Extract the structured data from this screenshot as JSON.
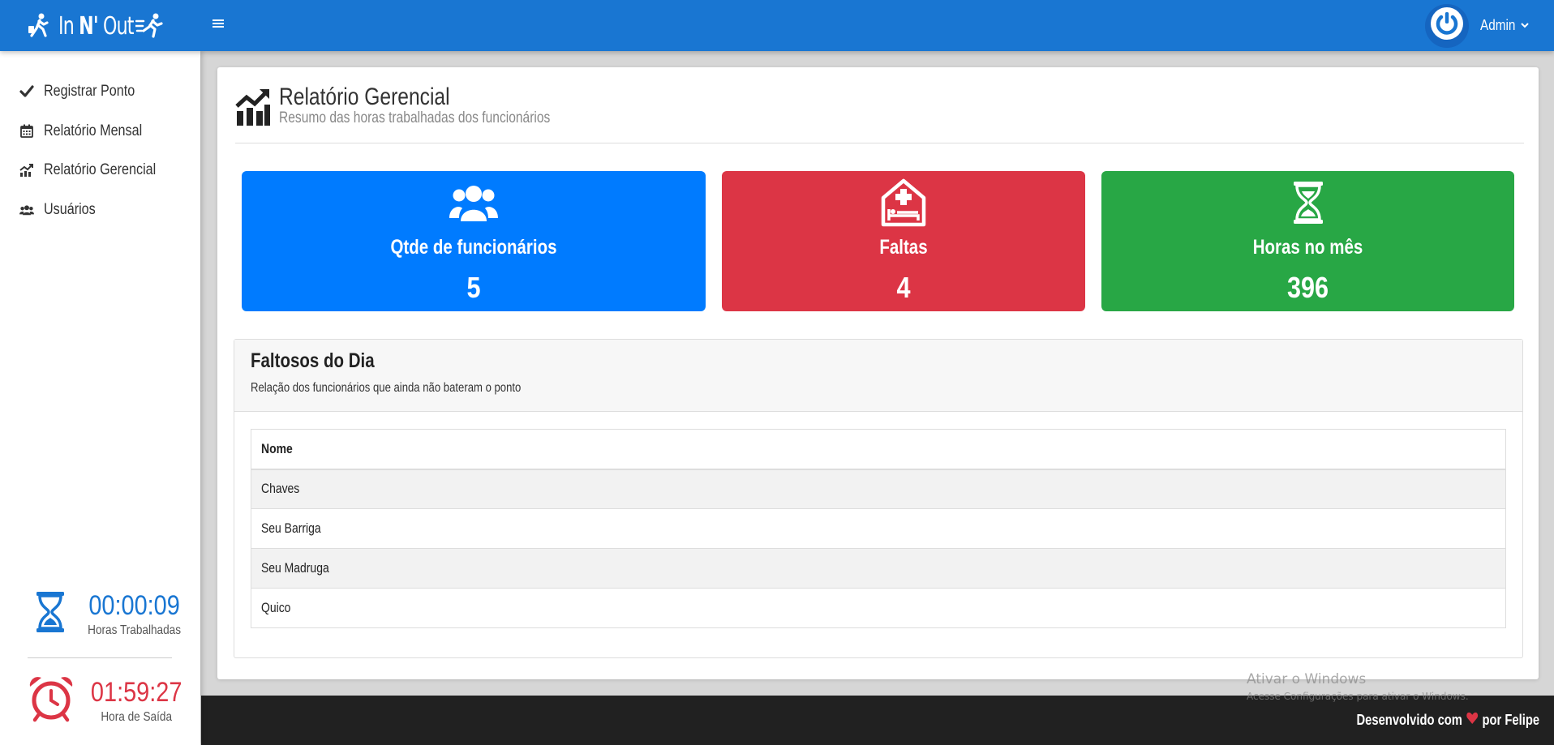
{
  "app": {
    "brand_prefix": "In ",
    "brand_bold": "N'",
    "brand_suffix": " Out"
  },
  "header": {
    "user_name": "Admin"
  },
  "sidebar": {
    "items": [
      {
        "label": "Registrar Ponto",
        "icon": "check-icon"
      },
      {
        "label": "Relatório Mensal",
        "icon": "calendar-icon"
      },
      {
        "label": "Relatório Gerencial",
        "icon": "chart-line-icon"
      },
      {
        "label": "Usuários",
        "icon": "users-icon"
      }
    ],
    "worked": {
      "value": "00:00:09",
      "label": "Horas Trabalhadas"
    },
    "exit": {
      "value": "01:59:27",
      "label": "Hora de Saída"
    }
  },
  "page": {
    "title": "Relatório Gerencial",
    "subtitle": "Resumo das horas trabalhadas dos funcionários"
  },
  "summary": {
    "employees": {
      "title": "Qtde de funcionários",
      "value": "5"
    },
    "absences": {
      "title": "Faltas",
      "value": "4"
    },
    "hours": {
      "title": "Horas no mês",
      "value": "396"
    }
  },
  "absentees": {
    "title": "Faltosos do Dia",
    "subtitle": "Relação dos funcionários que ainda não bateram o ponto",
    "column": "Nome",
    "rows": [
      "Chaves",
      "Seu Barriga",
      "Seu Madruga",
      "Quico"
    ]
  },
  "footer": {
    "text_before": "Desenvolvido com",
    "text_after": "por Felipe"
  },
  "watermark": {
    "line1": "Ativar o Windows",
    "line2": "Acesse Configurações para ativar o Windows."
  },
  "colors": {
    "header": "#1976d2",
    "blue": "#007bff",
    "red": "#dc3545",
    "green": "#28a745",
    "footer": "#212121"
  }
}
